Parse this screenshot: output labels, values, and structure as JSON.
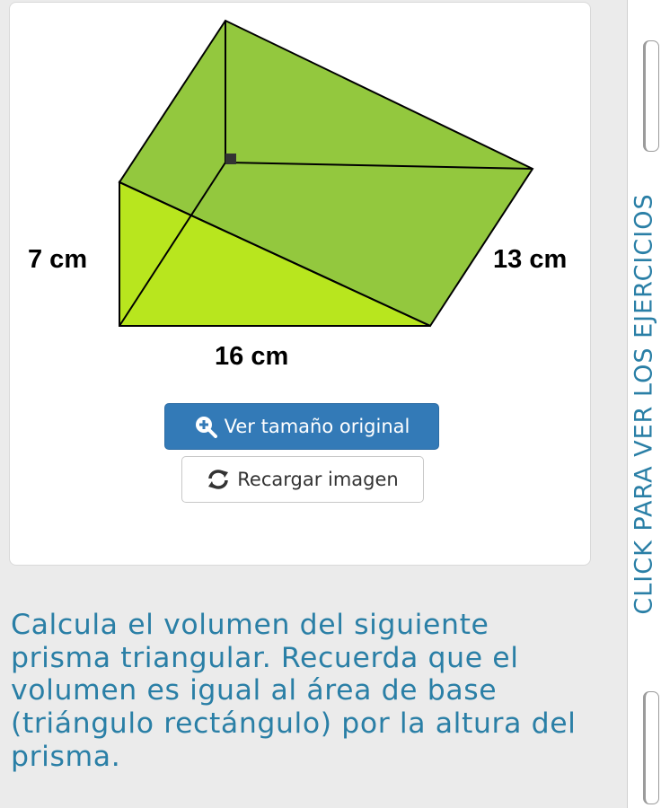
{
  "figure": {
    "label_height": "7 cm",
    "label_hypotenuse": "13 cm",
    "label_base": "16 cm"
  },
  "buttons": {
    "view_original": "Ver tamaño original",
    "reload_image": "Recargar imagen"
  },
  "question": "Calcula el volumen del siguiente prisma triangular. Recuerda que el volumen es igual al área de base (triángulo rectángulo) por la altura del prisma.",
  "side_tab": {
    "label": "CLICK PARA VER LOS EJERCICIOS"
  },
  "colors": {
    "accent": "#2a7fa6",
    "primary_button": "#337ab7",
    "prism_face": "#93c83e",
    "prism_front": "#b8e61e"
  }
}
